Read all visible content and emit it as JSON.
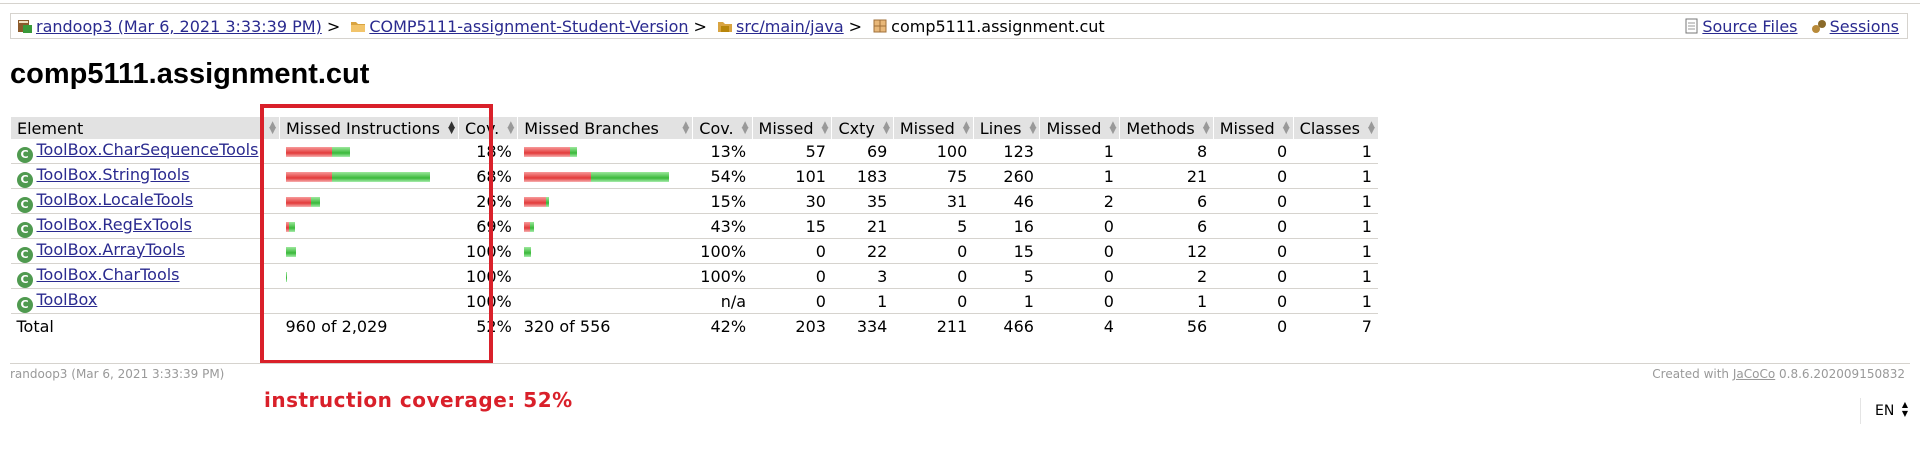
{
  "breadcrumb": {
    "session": "randoop3 (Mar 6, 2021 3:33:39 PM)",
    "project": "COMP5111-assignment-Student-Version",
    "source": "src/main/java",
    "package": "comp5111.assignment.cut",
    "sep": ">",
    "source_files": "Source Files",
    "sessions": "Sessions"
  },
  "title": "comp5111.assignment.cut",
  "headers": {
    "element": "Element",
    "missed_instructions": "Missed Instructions",
    "cov1": "Cov.",
    "missed_branches": "Missed Branches",
    "cov2": "Cov.",
    "missed_cxty": "Missed",
    "cxty": "Cxty",
    "missed_lines": "Missed",
    "lines": "Lines",
    "missed_methods": "Missed",
    "methods": "Methods",
    "missed_classes": "Missed",
    "classes": "Classes"
  },
  "rows": [
    {
      "name": "ToolBox.CharSequenceTools",
      "instr_red": 0.31,
      "instr_green": 0.12,
      "icov": "18%",
      "br_red": 0.31,
      "br_green": 0.05,
      "bcov": "13%",
      "mcx": "57",
      "cx": "69",
      "ml": "100",
      "l": "123",
      "mm": "1",
      "m": "8",
      "mc": "0",
      "c": "1"
    },
    {
      "name": "ToolBox.StringTools",
      "instr_red": 0.31,
      "instr_green": 0.66,
      "icov": "68%",
      "br_red": 0.45,
      "br_green": 0.53,
      "bcov": "54%",
      "mcx": "101",
      "cx": "183",
      "ml": "75",
      "l": "260",
      "mm": "1",
      "m": "21",
      "mc": "0",
      "c": "1"
    },
    {
      "name": "ToolBox.LocaleTools",
      "instr_red": 0.17,
      "instr_green": 0.06,
      "icov": "26%",
      "br_red": 0.15,
      "br_green": 0.02,
      "bcov": "15%",
      "mcx": "30",
      "cx": "35",
      "ml": "31",
      "l": "46",
      "mm": "2",
      "m": "6",
      "mc": "0",
      "c": "1"
    },
    {
      "name": "ToolBox.RegExTools",
      "instr_red": 0.02,
      "instr_green": 0.04,
      "icov": "69%",
      "br_red": 0.04,
      "br_green": 0.03,
      "bcov": "43%",
      "mcx": "15",
      "cx": "21",
      "ml": "5",
      "l": "16",
      "mm": "0",
      "m": "6",
      "mc": "0",
      "c": "1"
    },
    {
      "name": "ToolBox.ArrayTools",
      "instr_red": 0.0,
      "instr_green": 0.07,
      "icov": "100%",
      "br_red": 0.0,
      "br_green": 0.05,
      "bcov": "100%",
      "mcx": "0",
      "cx": "22",
      "ml": "0",
      "l": "15",
      "mm": "0",
      "m": "12",
      "mc": "0",
      "c": "1"
    },
    {
      "name": "ToolBox.CharTools",
      "instr_red": 0.0,
      "instr_green": 0.01,
      "icov": "100%",
      "br_red": 0.0,
      "br_green": 0.0,
      "bcov": "100%",
      "mcx": "0",
      "cx": "3",
      "ml": "0",
      "l": "5",
      "mm": "0",
      "m": "2",
      "mc": "0",
      "c": "1"
    },
    {
      "name": "ToolBox",
      "instr_red": 0.0,
      "instr_green": 0.0,
      "icov": "100%",
      "br_red": 0.0,
      "br_green": 0.0,
      "bcov": "n/a",
      "mcx": "0",
      "cx": "1",
      "ml": "0",
      "l": "1",
      "mm": "0",
      "m": "1",
      "mc": "0",
      "c": "1"
    }
  ],
  "total": {
    "label": "Total",
    "instr": "960 of 2,029",
    "icov": "52%",
    "br": "320 of 556",
    "bcov": "42%",
    "mcx": "203",
    "cx": "334",
    "ml": "211",
    "l": "466",
    "mm": "4",
    "m": "56",
    "mc": "0",
    "c": "7"
  },
  "footer": {
    "left": "randoop3 (Mar 6, 2021 3:33:39 PM)",
    "created_with": "Created with",
    "jacoco": "JaCoCo",
    "version": "0.8.6.202009150832"
  },
  "annotation": "instruction coverage: 52%",
  "language": "EN",
  "colors": {
    "annotation": "#d9202a",
    "missed": "#e23a3a",
    "covered": "#3ab83a",
    "link": "#2a2a8f"
  }
}
